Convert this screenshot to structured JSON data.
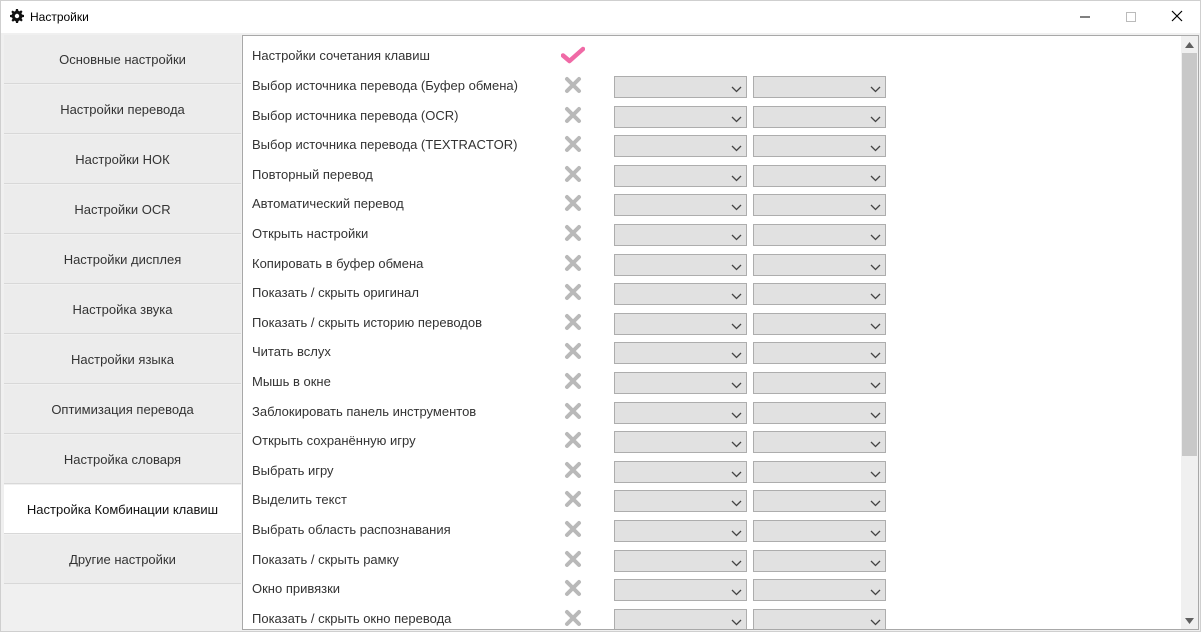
{
  "window": {
    "title": "Настройки",
    "icon": "gear-icon",
    "controls": [
      "minimize-icon",
      "maximize-icon",
      "close-icon"
    ]
  },
  "sidebar": {
    "active_index": 9,
    "items": [
      {
        "label": "Основные настройки"
      },
      {
        "label": "Настройки перевода"
      },
      {
        "label": "Настройки НОК"
      },
      {
        "label": "Настройки OCR"
      },
      {
        "label": "Настройки дисплея"
      },
      {
        "label": "Настройка звука"
      },
      {
        "label": "Настройки языка"
      },
      {
        "label": "Оптимизация перевода"
      },
      {
        "label": "Настройка словаря"
      },
      {
        "label": "Настройка Комбинации клавиш"
      },
      {
        "label": "Другие настройки"
      }
    ]
  },
  "hotkeys": {
    "master": {
      "label": "Настройки сочетания клавиш",
      "enabled": true
    },
    "rows": [
      {
        "label": "Выбор источника перевода (Буфер обмена)",
        "enabled": false,
        "key1": "",
        "key2": ""
      },
      {
        "label": "Выбор источника перевода (OCR)",
        "enabled": false,
        "key1": "",
        "key2": ""
      },
      {
        "label": "Выбор источника перевода (TEXTRACTOR)",
        "enabled": false,
        "key1": "",
        "key2": ""
      },
      {
        "label": "Повторный перевод",
        "enabled": false,
        "key1": "",
        "key2": ""
      },
      {
        "label": "Автоматический перевод",
        "enabled": false,
        "key1": "",
        "key2": ""
      },
      {
        "label": "Открыть настройки",
        "enabled": false,
        "key1": "",
        "key2": ""
      },
      {
        "label": "Копировать в буфер обмена",
        "enabled": false,
        "key1": "",
        "key2": ""
      },
      {
        "label": "Показать / скрыть оригинал",
        "enabled": false,
        "key1": "",
        "key2": ""
      },
      {
        "label": "Показать / скрыть историю переводов",
        "enabled": false,
        "key1": "",
        "key2": ""
      },
      {
        "label": "Читать вслух",
        "enabled": false,
        "key1": "",
        "key2": ""
      },
      {
        "label": "Мышь в окне",
        "enabled": false,
        "key1": "",
        "key2": ""
      },
      {
        "label": "Заблокировать панель инструментов",
        "enabled": false,
        "key1": "",
        "key2": ""
      },
      {
        "label": "Открыть сохранённую игру",
        "enabled": false,
        "key1": "",
        "key2": ""
      },
      {
        "label": "Выбрать игру",
        "enabled": false,
        "key1": "",
        "key2": ""
      },
      {
        "label": "Выделить текст",
        "enabled": false,
        "key1": "",
        "key2": ""
      },
      {
        "label": "Выбрать область распознавания",
        "enabled": false,
        "key1": "",
        "key2": ""
      },
      {
        "label": "Показать / скрыть рамку",
        "enabled": false,
        "key1": "",
        "key2": ""
      },
      {
        "label": "Окно привязки",
        "enabled": false,
        "key1": "",
        "key2": ""
      },
      {
        "label": "Показать / скрыть окно перевода",
        "enabled": false,
        "key1": "",
        "key2": ""
      }
    ]
  },
  "colors": {
    "check_enabled": "#f06aa6",
    "x_disabled": "#b9b9b9",
    "combo_bg": "#e1e1e1",
    "active_tab_bg": "#ffffff"
  }
}
